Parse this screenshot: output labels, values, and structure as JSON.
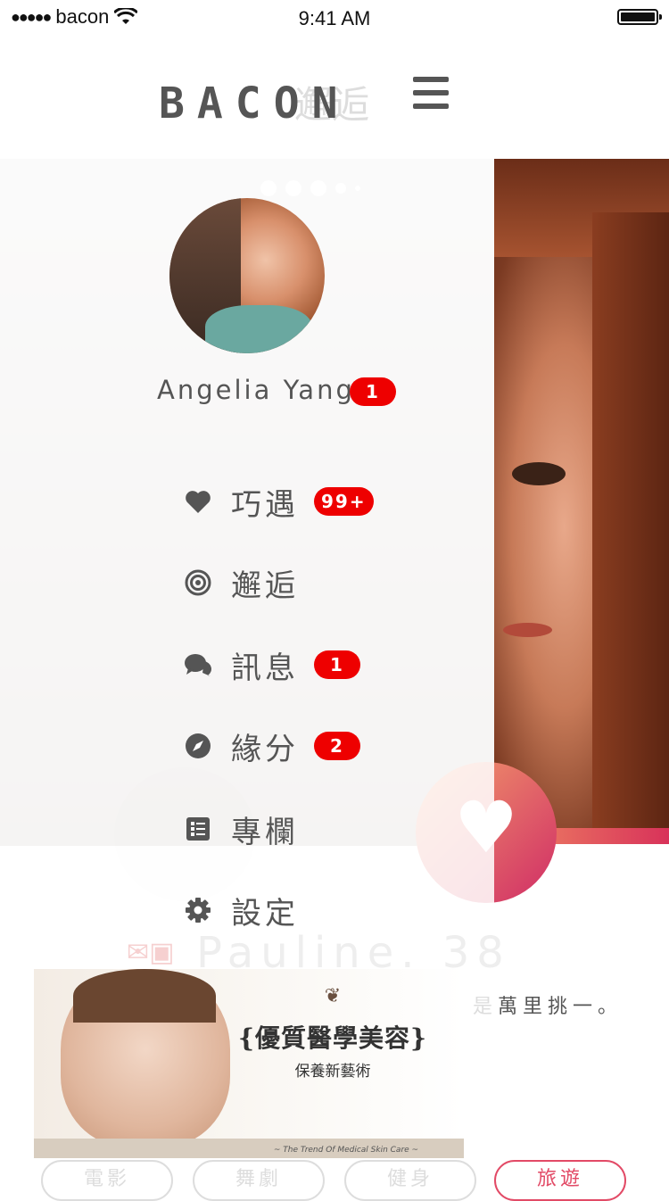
{
  "status_bar": {
    "signal": "●●●●●",
    "carrier": "bacon",
    "time": "9:41 AM"
  },
  "header": {
    "logo": "BACON",
    "ghost_title": "邂逅",
    "menu_icon": "hamburger-menu-icon"
  },
  "profile": {
    "name": "Angelia Yang",
    "badge": "1"
  },
  "menu": [
    {
      "label": "巧遇",
      "icon": "heart-icon",
      "badge": "99+"
    },
    {
      "label": "邂逅",
      "icon": "target-icon",
      "badge": ""
    },
    {
      "label": "訊息",
      "icon": "chat-bubbles-icon",
      "badge": "1"
    },
    {
      "label": "緣分",
      "icon": "compass-icon",
      "badge": "2"
    },
    {
      "label": "專欄",
      "icon": "article-list-icon",
      "badge": ""
    },
    {
      "label": "設定",
      "icon": "gear-icon",
      "badge": ""
    }
  ],
  "background_card": {
    "name": "Pauline. 38",
    "quote_prefix": "是",
    "quote": "萬里挑一。"
  },
  "ad": {
    "title": "{優質醫學美容}",
    "subtitle": "保養新藝術",
    "footer_right": "~ The Trend Of Medical Skin Care ~"
  },
  "tags": [
    "電影",
    "舞劇",
    "健身",
    "旅遊"
  ],
  "colors": {
    "accent_red": "#ee0000",
    "like_gradient_start": "#f4a06a",
    "like_gradient_end": "#d02c66",
    "tag_active": "#e24a66"
  }
}
